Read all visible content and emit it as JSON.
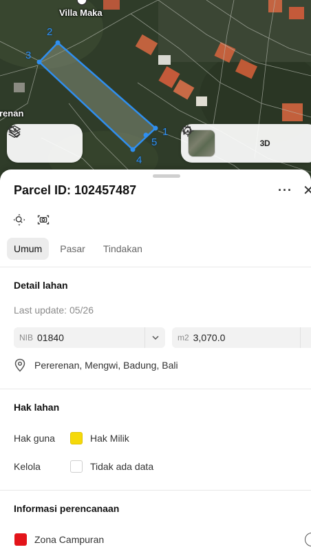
{
  "map": {
    "place_label": "Villa Maka",
    "side_label": "renan",
    "vertices": [
      "1",
      "2",
      "3",
      "4",
      "5"
    ],
    "layers_icon": "layers-icon",
    "measure_icon": "ruler-icon",
    "locate_icon": "crosshair-icon",
    "three_d_label": "3D",
    "share_icon": "chat-share-icon",
    "parcel_color": "#2f8ff0"
  },
  "sheet": {
    "title": "Parcel ID: 102457487",
    "more_label": "···",
    "close_label": "✕",
    "tabs": [
      {
        "label": "Umum",
        "active": true
      },
      {
        "label": "Pasar",
        "active": false
      },
      {
        "label": "Tindakan",
        "active": false
      }
    ],
    "detail": {
      "heading": "Detail lahan",
      "last_update": "Last update: 05/26",
      "nib_unit": "NIB",
      "nib_value": "01840",
      "area_unit": "m2",
      "area_value": "3,070.0",
      "location": "Pererenan, Mengwi, Badung, Bali"
    },
    "rights": {
      "heading": "Hak lahan",
      "rows": [
        {
          "label": "Hak guna",
          "value": "Hak Milik",
          "color": "#f5d90a"
        },
        {
          "label": "Kelola",
          "value": "Tidak ada data",
          "color": "#ffffff"
        }
      ]
    },
    "planning": {
      "heading": "Informasi perencanaan",
      "zone": "Zona Campuran",
      "zone_color": "#e3141a"
    }
  }
}
